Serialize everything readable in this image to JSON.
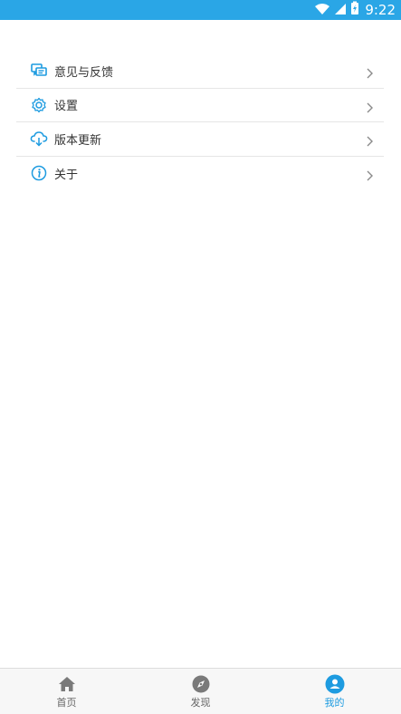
{
  "status_bar": {
    "time": "9:22",
    "icons": [
      "wifi-icon",
      "cell-signal-icon",
      "battery-charging-icon"
    ]
  },
  "colors": {
    "accent": "#2aa6e6",
    "icon_blue": "#1d9be0",
    "nav_inactive": "#7a7a7a"
  },
  "menu": {
    "items": [
      {
        "label": "意见与反馈",
        "icon": "feedback-icon"
      },
      {
        "label": "设置",
        "icon": "gear-icon"
      },
      {
        "label": "版本更新",
        "icon": "cloud-download-icon"
      },
      {
        "label": "关于",
        "icon": "info-icon"
      }
    ]
  },
  "bottom_nav": {
    "items": [
      {
        "label": "首页",
        "icon": "home-icon",
        "active": false
      },
      {
        "label": "发现",
        "icon": "compass-icon",
        "active": false
      },
      {
        "label": "我的",
        "icon": "user-icon",
        "active": true
      }
    ]
  }
}
